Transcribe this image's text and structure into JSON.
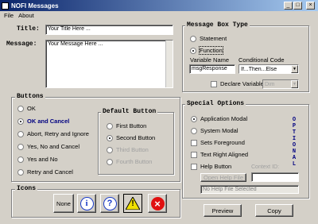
{
  "window": {
    "title": "NOFI Messages",
    "min_glyph": "_",
    "max_glyph": "□",
    "close_glyph": "×"
  },
  "menu": {
    "file": "File",
    "about": "About"
  },
  "form": {
    "title_label": "Title:",
    "title_value": "Your Title Here ...",
    "message_label": "Message:",
    "message_value": "Your Message Here ..."
  },
  "buttons_group": {
    "legend": "Buttons",
    "items": [
      {
        "label": "OK",
        "selected": false
      },
      {
        "label": "OK and Cancel",
        "selected": true
      },
      {
        "label": "Abort, Retry and Ignore",
        "selected": false
      },
      {
        "label": "Yes, No and Cancel",
        "selected": false
      },
      {
        "label": "Yes and No",
        "selected": false
      },
      {
        "label": "Retry and Cancel",
        "selected": false
      }
    ]
  },
  "default_button": {
    "legend": "Default Button",
    "items": [
      {
        "label": "First Button",
        "selected": false,
        "enabled": true
      },
      {
        "label": "Second Button",
        "selected": true,
        "enabled": true
      },
      {
        "label": "Third Button",
        "selected": false,
        "enabled": false
      },
      {
        "label": "Fourth Button",
        "selected": false,
        "enabled": false
      }
    ]
  },
  "icons": {
    "legend": "Icons",
    "none_label": "None",
    "info_glyph": "i",
    "question_glyph": "?",
    "warning_glyph": "!",
    "error_glyph": "×"
  },
  "msgbox_type": {
    "legend": "Message Box Type",
    "statement": "Statement",
    "function": "Function",
    "variable_name_label": "Variable Name",
    "variable_name_value": "msgResponse",
    "conditional_code_label": "Conditional Code",
    "conditional_code_value": "If...Then...Else",
    "declare_variable_label": "Declare Variable",
    "declare_type_value": "Dim",
    "arrow_glyph": "▼"
  },
  "special_options": {
    "legend": "Special Options",
    "items": [
      {
        "label": "Application Modal",
        "kind": "radio",
        "checked": true
      },
      {
        "label": "System Modal",
        "kind": "radio",
        "checked": false
      },
      {
        "label": "Sets Foreground",
        "kind": "check",
        "checked": false
      },
      {
        "label": "Text Right Aligned",
        "kind": "check",
        "checked": false
      },
      {
        "label": "Help Button",
        "kind": "check",
        "checked": false
      }
    ],
    "context_id_label": "Context ID:",
    "open_help_file": "Open Help File",
    "no_help_file": "No Help File Selected",
    "optional_text": "OPTIONAL"
  },
  "actions": {
    "preview": "Preview",
    "copy": "Copy"
  },
  "colors": {
    "titlebar": "#0a246a",
    "optional": "#000080",
    "info": "#1a3cc8",
    "warning": "#f0e000",
    "error": "#e01010"
  }
}
